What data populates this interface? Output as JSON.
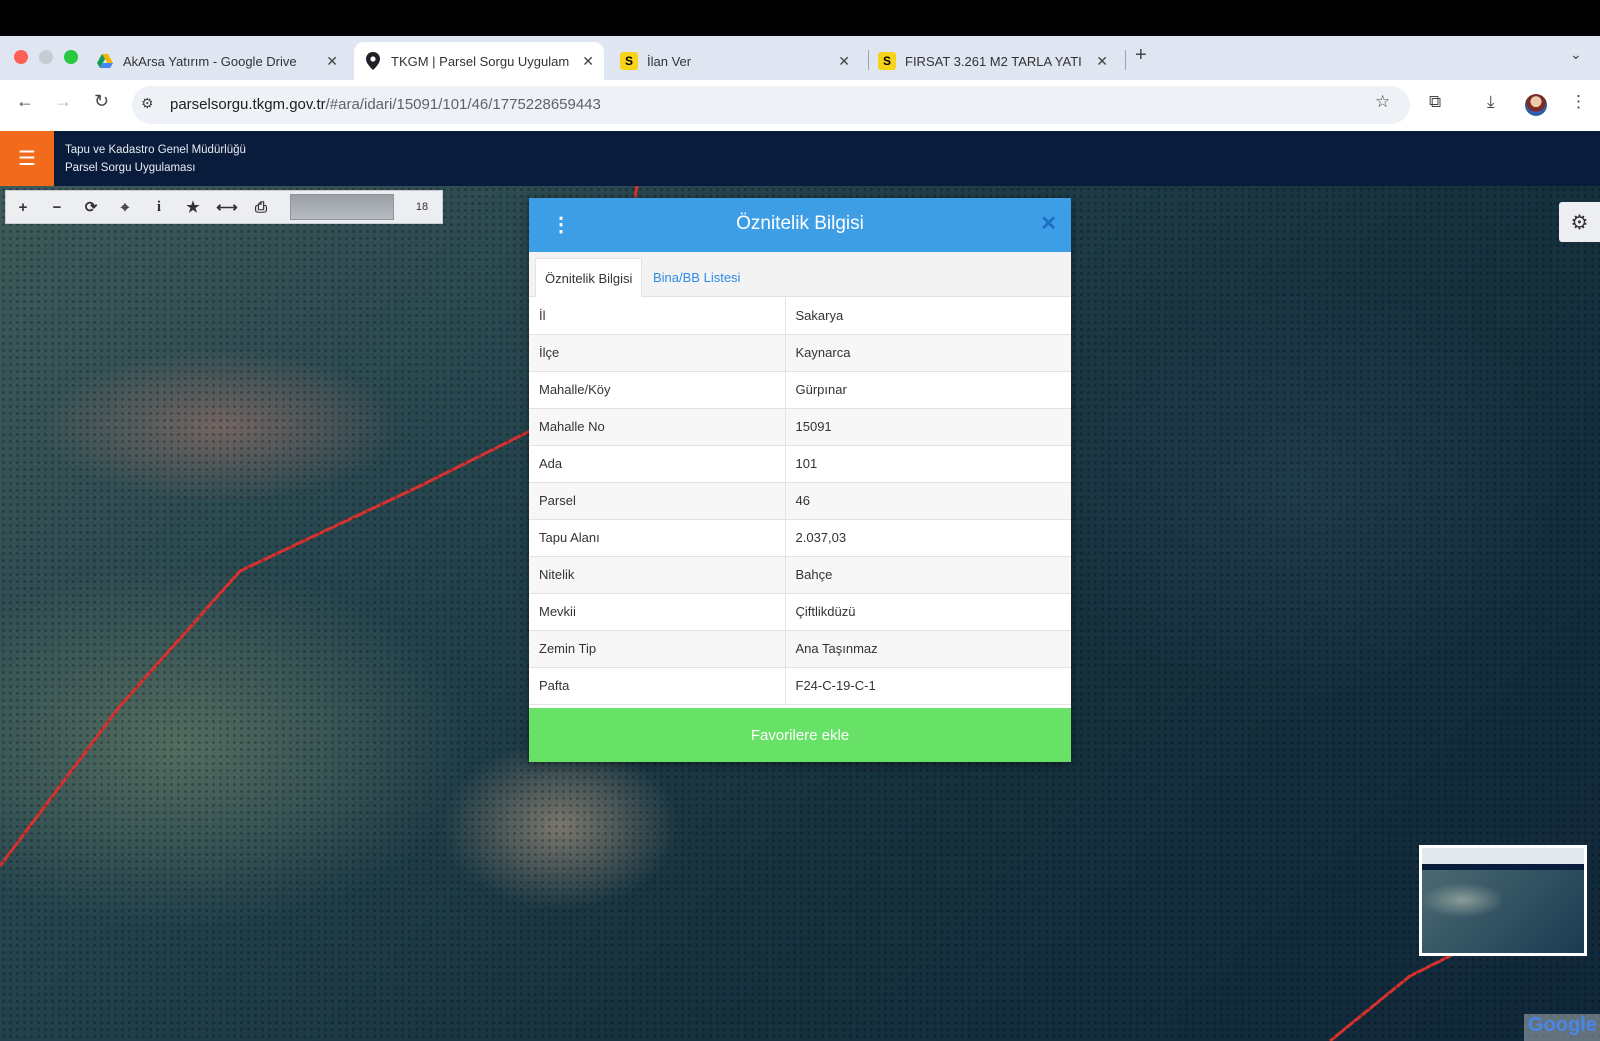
{
  "browser": {
    "tabs": [
      {
        "title": "AkArsa Yatırım - Google Drive",
        "icon": "google-drive-icon"
      },
      {
        "title": "TKGM | Parsel Sorgu Uygulam",
        "icon": "map-pin-icon"
      },
      {
        "title": "İlan Ver",
        "icon": "s-favicon",
        "letter": "S"
      },
      {
        "title": "FIRSAT 3.261 M2 TARLA YATI",
        "icon": "s-favicon",
        "letter": "S"
      }
    ],
    "url_host": "parselsorgu.tkgm.gov.tr",
    "url_path": "/#ara/idari/15091/101/46/1775228659443"
  },
  "app": {
    "org_name": "Tapu ve Kadastro Genel Müdürlüğü",
    "app_name": "Parsel Sorgu Uygulaması"
  },
  "map_toolbar": {
    "zoom_level": "18"
  },
  "modal": {
    "title": "Öznitelik Bilgisi",
    "tabs": [
      "Öznitelik Bilgisi",
      "Bina/BB Listesi"
    ],
    "rows": [
      {
        "key": "İl",
        "value": "Sakarya"
      },
      {
        "key": "İlçe",
        "value": "Kaynarca"
      },
      {
        "key": "Mahalle/Köy",
        "value": "Gürpınar"
      },
      {
        "key": "Mahalle No",
        "value": "15091"
      },
      {
        "key": "Ada",
        "value": "101"
      },
      {
        "key": "Parsel",
        "value": "46"
      },
      {
        "key": "Tapu Alanı",
        "value": "2.037,03"
      },
      {
        "key": "Nitelik",
        "value": "Bahçe"
      },
      {
        "key": "Mevkii",
        "value": "Çiftlikdüzü"
      },
      {
        "key": "Zemin Tip",
        "value": "Ana Taşınmaz"
      },
      {
        "key": "Pafta",
        "value": "F24-C-19-C-1"
      }
    ],
    "favorite_button": "Favorilere ekle"
  },
  "attribution": "Google",
  "colors": {
    "header_bg": "#0a1c3c",
    "menu_accent": "#f26a1b",
    "modal_header": "#3d9ee5",
    "favorite_button": "#67e266",
    "parcel_boundary": "#d8322f"
  }
}
